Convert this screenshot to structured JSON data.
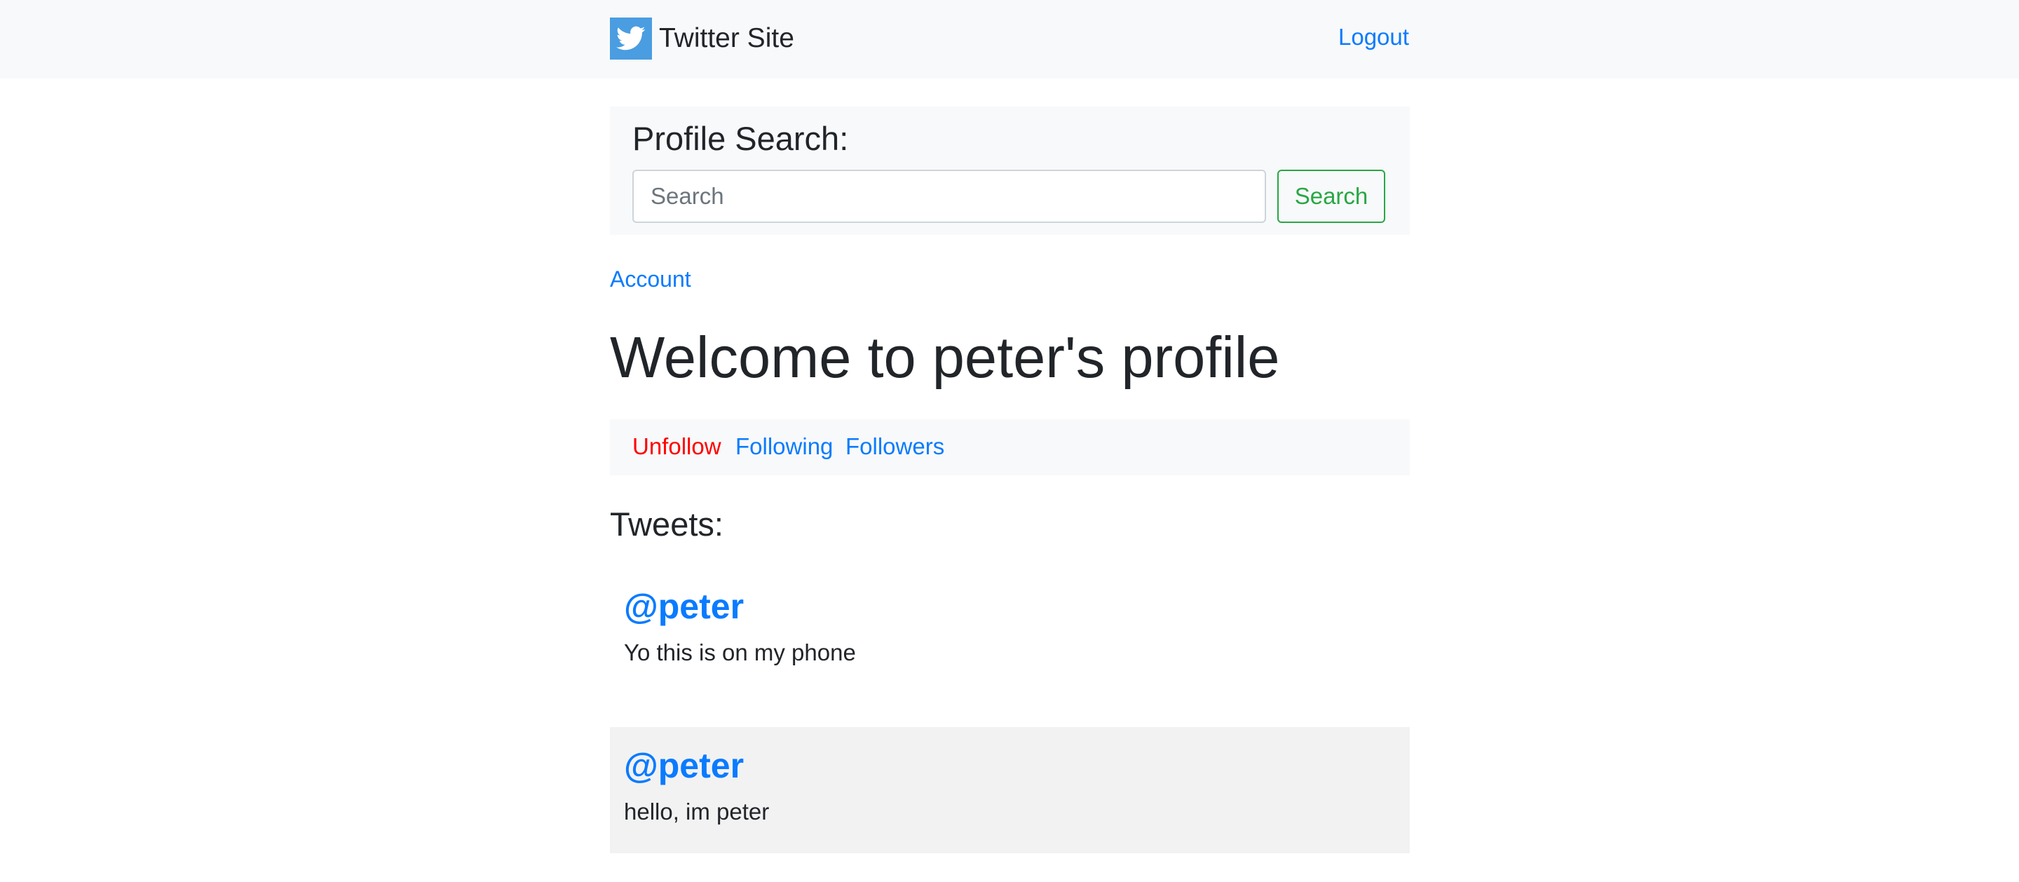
{
  "navbar": {
    "brand_name": "Twitter Site",
    "brand_icon": "twitter-bird-icon",
    "logout_label": "Logout"
  },
  "search": {
    "title": "Profile Search:",
    "placeholder": "Search",
    "value": "",
    "button_label": "Search"
  },
  "account_link": "Account",
  "page_title": "Welcome to peter's profile",
  "profile_nav": {
    "unfollow_label": "Unfollow",
    "following_label": "Following",
    "followers_label": "Followers"
  },
  "tweets_heading": "Tweets:",
  "tweets": [
    {
      "handle": "@peter",
      "text": "Yo this is on my phone"
    },
    {
      "handle": "@peter",
      "text": "hello, im peter"
    }
  ],
  "colors": {
    "link": "#0a7bff",
    "unfollow": "#ff0000",
    "search_button": "#28a745",
    "brand_logo_bg": "#4a9de0"
  }
}
